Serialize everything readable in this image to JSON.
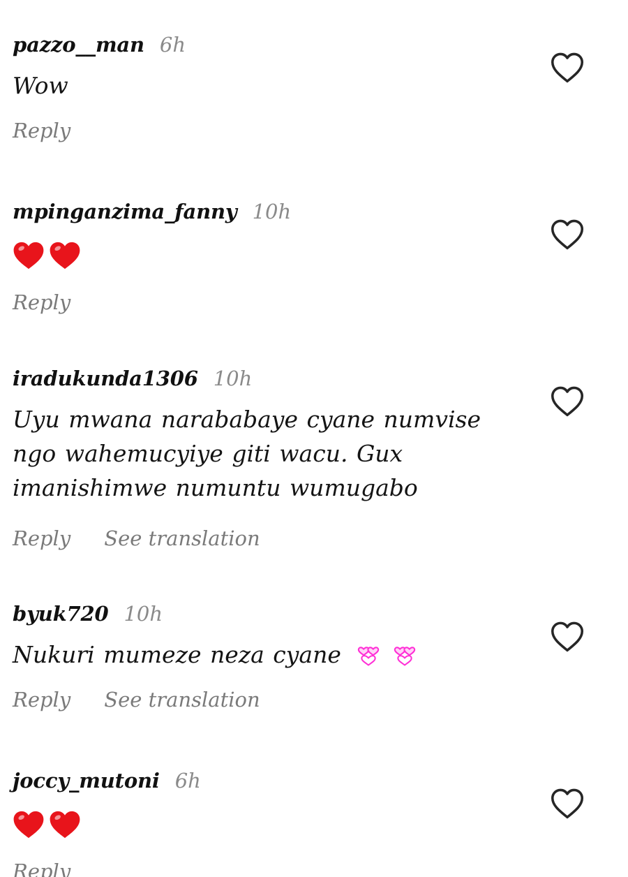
{
  "comments": [
    {
      "username": "pazzo__man",
      "time": "6h",
      "text": "Wow",
      "reply_label": "Reply"
    },
    {
      "username": "mpinganzima_fanny",
      "time": "10h",
      "emoji": "❤️❤️",
      "reply_label": "Reply"
    },
    {
      "username": "iradukunda1306",
      "time": "10h",
      "text": "Uyu mwana narababaye cyane numvise ngo wahemucyiye giti wacu. Gux imanishimwe numuntu wumugabo",
      "reply_label": "Reply",
      "translate_label": "See translation"
    },
    {
      "username": "byuk720",
      "time": "10h",
      "text": "Nukuri mumeze neza cyane",
      "emoji": "💞💞",
      "reply_label": "Reply",
      "translate_label": "See translation"
    },
    {
      "username": "joccy_mutoni",
      "time": "6h",
      "emoji": "❤️❤️",
      "reply_label": "Reply"
    }
  ],
  "colors": {
    "username": "#111111",
    "timestamp": "#8a8a8a",
    "action": "#7a7a7a",
    "heart_emoji": "#e8141b",
    "mini_hearts": "#ff2fd6",
    "like_outline": "#262626"
  },
  "icons": {
    "like": "heart-outline-icon",
    "emoji_red": "red-heart-emoji",
    "emoji_pink": "two-hearts-emoji"
  }
}
